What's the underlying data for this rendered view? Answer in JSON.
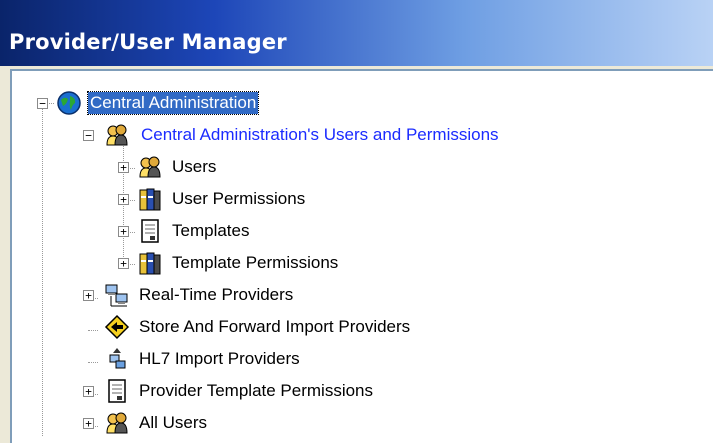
{
  "window": {
    "title": "Provider/User Manager"
  },
  "tree": {
    "root": {
      "label": "Central Administration",
      "expander": "−",
      "icon": "globe-icon"
    },
    "users_permissions": {
      "label": "Central Administration's Users and Permissions",
      "expander": "−",
      "icon": "users-group-icon"
    },
    "users": {
      "label": "Users",
      "expander": "+",
      "icon": "users-group-icon"
    },
    "user_permissions": {
      "label": "User Permissions",
      "expander": "+",
      "icon": "permissions-binder-icon"
    },
    "templates": {
      "label": "Templates",
      "expander": "+",
      "icon": "template-document-icon"
    },
    "template_permissions": {
      "label": "Template Permissions",
      "expander": "+",
      "icon": "permissions-binder-icon"
    },
    "real_time": {
      "label": "Real-Time Providers",
      "expander": "+",
      "icon": "network-computers-icon"
    },
    "store_forward": {
      "label": "Store And Forward Import Providers",
      "icon": "diamond-arrow-icon"
    },
    "hl7": {
      "label": "HL7 Import Providers",
      "icon": "hl7-import-icon"
    },
    "provider_template_permissions": {
      "label": "Provider Template Permissions",
      "expander": "+",
      "icon": "template-document-icon"
    },
    "all_users": {
      "label": "All Users",
      "expander": "+",
      "icon": "users-group-icon"
    }
  },
  "colors": {
    "selection": "#316ac5",
    "link_blue": "#1b2bff",
    "title_gradient_start": "#0a246a"
  }
}
